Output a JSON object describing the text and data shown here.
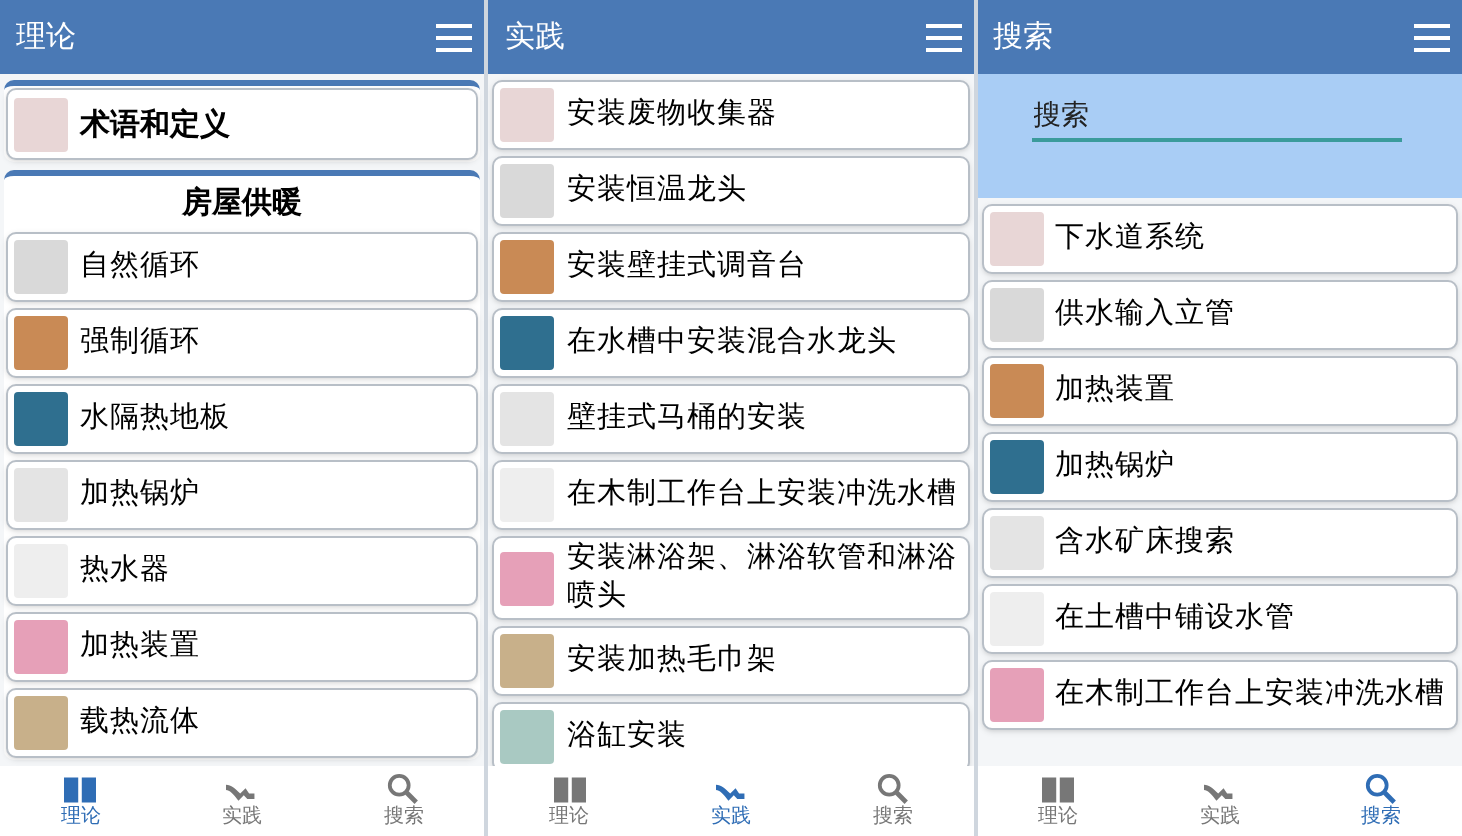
{
  "panels": [
    {
      "header": {
        "title": "理论"
      },
      "groups": [
        {
          "kind": "featured",
          "items": [
            {
              "label": "术语和定义"
            }
          ]
        },
        {
          "kind": "list",
          "heading": "房屋供暖",
          "items": [
            {
              "label": "自然循环"
            },
            {
              "label": "强制循环"
            },
            {
              "label": "水隔热地板"
            },
            {
              "label": "加热锅炉"
            },
            {
              "label": "热水器"
            },
            {
              "label": "加热装置"
            },
            {
              "label": "载热流体"
            }
          ]
        }
      ],
      "nav": [
        {
          "label": "理论",
          "selected": true
        },
        {
          "label": "实践",
          "selected": false
        },
        {
          "label": "搜索",
          "selected": false
        }
      ]
    },
    {
      "header": {
        "title": "实践"
      },
      "groups": [
        {
          "kind": "list",
          "items": [
            {
              "label": "安装废物收集器"
            },
            {
              "label": "安装恒温龙头"
            },
            {
              "label": "安装壁挂式调音台"
            },
            {
              "label": "在水槽中安装混合水龙头"
            },
            {
              "label": "壁挂式马桶的安装"
            },
            {
              "label": "在木制工作台上安装冲洗水槽"
            },
            {
              "label": "安装淋浴架、淋浴软管和淋浴喷头"
            },
            {
              "label": "安装加热毛巾架"
            },
            {
              "label": "浴缸安装"
            }
          ]
        }
      ],
      "nav": [
        {
          "label": "理论",
          "selected": false
        },
        {
          "label": "实践",
          "selected": true
        },
        {
          "label": "搜索",
          "selected": false
        }
      ]
    },
    {
      "header": {
        "title": "搜索"
      },
      "search": {
        "placeholder": "搜索"
      },
      "groups": [
        {
          "kind": "list",
          "items": [
            {
              "label": "下水道系统"
            },
            {
              "label": "供水输入立管"
            },
            {
              "label": "加热装置"
            },
            {
              "label": "加热锅炉"
            },
            {
              "label": "含水矿床搜索"
            },
            {
              "label": "在土槽中铺设水管"
            },
            {
              "label": "在木制工作台上安装冲洗水槽"
            }
          ]
        }
      ],
      "nav": [
        {
          "label": "理论",
          "selected": false
        },
        {
          "label": "实践",
          "selected": false
        },
        {
          "label": "搜索",
          "selected": true
        }
      ]
    }
  ]
}
